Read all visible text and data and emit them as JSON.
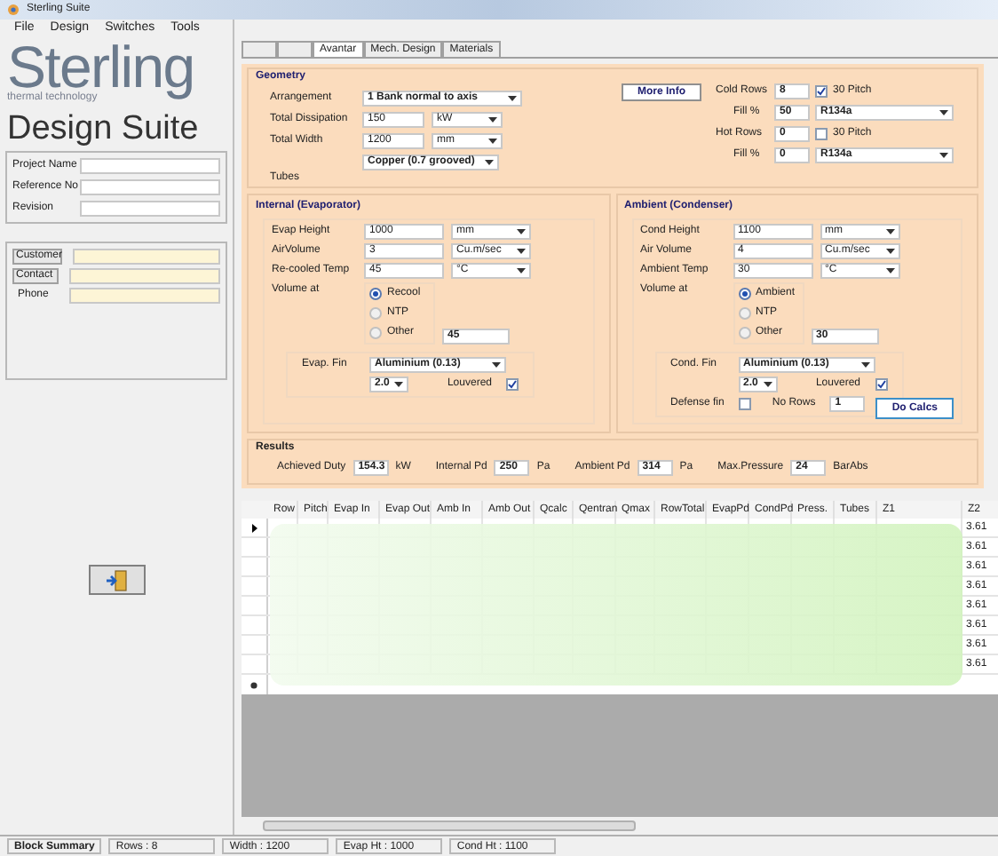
{
  "window": {
    "title": "Sterling Suite"
  },
  "menu": [
    "File",
    "Design",
    "Switches",
    "Tools"
  ],
  "logo": {
    "name": "Sterling",
    "tagline": "thermal technology",
    "heading": "Design Suite"
  },
  "project_fields": [
    {
      "label": "Project Name"
    },
    {
      "label": "Reference No"
    },
    {
      "label": "Revision"
    }
  ],
  "contact_fields": [
    {
      "kind": "button",
      "label": "Customer"
    },
    {
      "kind": "button",
      "label": "Contact"
    },
    {
      "kind": "label",
      "label": "Phone"
    }
  ],
  "tabs": [
    {
      "selected": false
    },
    {
      "selected": false
    },
    {
      "label": "Avantar",
      "selected": true
    },
    {
      "label": "Mech. Design",
      "selected": false
    },
    {
      "label": "Materials",
      "selected": false
    }
  ],
  "geometry": {
    "title": "Geometry",
    "fields": [
      {
        "kind": "select",
        "label": "Arrangement",
        "value": "1 Bank normal to axis"
      },
      {
        "kind": "unit",
        "label": "Total Dissipation",
        "value": "150",
        "unit": "kW"
      },
      {
        "kind": "unit",
        "label": "Total Width",
        "value": "1200",
        "unit": "mm"
      },
      {
        "kind": "tubes",
        "label": "Tubes",
        "value": "Copper (0.7 grooved)"
      }
    ],
    "more_info": "More Info",
    "rows": [
      {
        "label": "Cold Rows",
        "value": "8",
        "check_label": "30 Pitch",
        "checked": true
      },
      {
        "label": "Fill %",
        "value": "50",
        "refrigerant": "R134a"
      },
      {
        "label": "Hot Rows",
        "value": "0",
        "check_label": "30 Pitch",
        "checked": false
      },
      {
        "label": "Fill %",
        "value": "0",
        "refrigerant": "R134a"
      }
    ]
  },
  "sections": [
    {
      "title": "Internal (Evaporator)",
      "fields": [
        {
          "label": "Evap Height",
          "value": "1000",
          "unit": "mm"
        },
        {
          "label": "AirVolume",
          "value": "3",
          "unit": "Cu.m/sec"
        },
        {
          "label": "Re-cooled Temp",
          "value": "45",
          "unit": "°C"
        }
      ],
      "volume_label": "Volume at",
      "radios": [
        {
          "label": "Recool",
          "selected": true
        },
        {
          "label": "NTP",
          "selected": false
        },
        {
          "label": "Other",
          "selected": false
        }
      ],
      "other_value": "45",
      "fin_label": "Evap. Fin",
      "fin": "Aluminium (0.13)",
      "fin_spacing": "2.0",
      "louvered_label": "Louvered",
      "louvered": true
    },
    {
      "title": "Ambient (Condenser)",
      "fields": [
        {
          "label": "Cond Height",
          "value": "1100",
          "unit": "mm"
        },
        {
          "label": "Air Volume",
          "value": "4",
          "unit": "Cu.m/sec"
        },
        {
          "label": "Ambient Temp",
          "value": "30",
          "unit": "°C"
        }
      ],
      "volume_label": "Volume at",
      "radios": [
        {
          "label": "Ambient",
          "selected": true
        },
        {
          "label": "NTP",
          "selected": false
        },
        {
          "label": "Other",
          "selected": false
        }
      ],
      "other_value": "30",
      "fin_label": "Cond. Fin",
      "fin": "Aluminium (0.13)",
      "fin_spacing": "2.0",
      "louvered_label": "Louvered",
      "louvered": true,
      "defense_label": "Defense fin",
      "defense": false,
      "no_rows_label": "No Rows",
      "no_rows": "1",
      "action": "Do Calcs"
    }
  ],
  "results": {
    "title": "Results",
    "items": [
      {
        "label": "Achieved Duty",
        "value": "154.3",
        "unit": "kW"
      },
      {
        "label": "Internal Pd",
        "value": "250",
        "unit": "Pa"
      },
      {
        "label": "Ambient Pd",
        "value": "314",
        "unit": "Pa"
      },
      {
        "label": "Max.Pressure",
        "value": "24",
        "unit": "BarAbs"
      }
    ]
  },
  "table": {
    "columns": [
      "Row",
      "Pitch",
      "Evap In",
      "Evap Out",
      "Amb In",
      "Amb Out",
      "Qcalc",
      "Qentran",
      "Qmax",
      "RowTotal",
      "EvapPd",
      "CondPd",
      "Press.",
      "Tubes",
      "Z1",
      "Z2"
    ],
    "rows": [
      {
        "z2": "3.61"
      },
      {
        "z2": "3.61"
      },
      {
        "z2": "3.61"
      },
      {
        "z2": "3.61"
      },
      {
        "z2": "3.61"
      },
      {
        "z2": "3.61"
      },
      {
        "z2": "3.61"
      },
      {
        "z2": "3.61"
      }
    ]
  },
  "status_bar": [
    "Block Summary",
    "Rows : 8",
    "Width : 1200",
    "Evap Ht : 1000",
    "Cond Ht : 1100"
  ]
}
